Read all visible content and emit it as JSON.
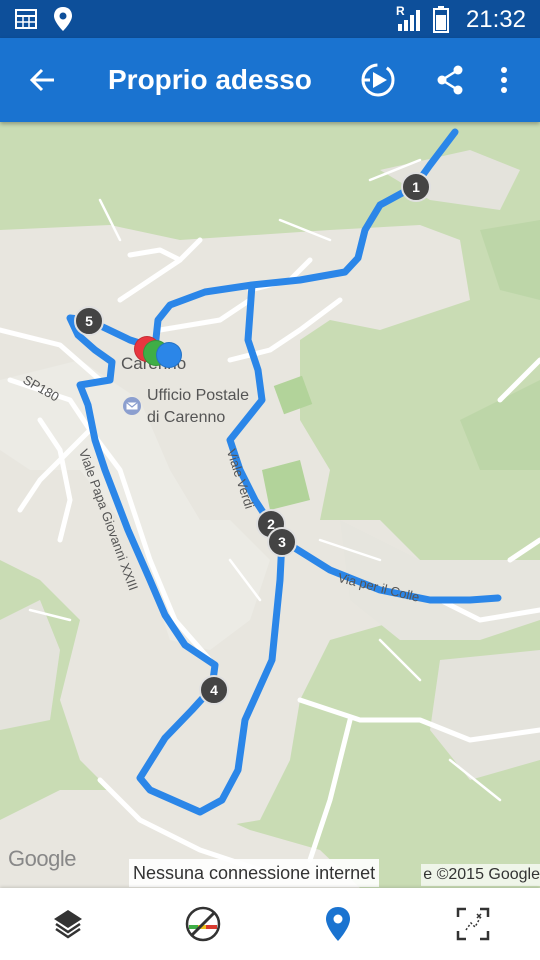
{
  "status_bar": {
    "time": "21:32",
    "network_indicator": "R",
    "icons": [
      "calendar-icon",
      "location-icon",
      "signal-icon",
      "battery-icon"
    ]
  },
  "app_bar": {
    "title": "Proprio adesso",
    "icons": [
      "back-arrow-icon",
      "play-route-icon",
      "share-icon",
      "more-vert-icon"
    ],
    "color": "#1a73d0",
    "status_color": "#0d4f9a"
  },
  "map": {
    "route_color": "#2b86e8",
    "place_labels": {
      "town": "Carenno",
      "post_office_line1": "Ufficio Postale",
      "post_office_line2": "di Carenno",
      "road_sp180": "SP180",
      "road_papa": "Viale Papa Giovanni XXIII",
      "road_verdi": "Viale Verdi",
      "road_colle": "Via per il Colle"
    },
    "waypoints": [
      "1",
      "2",
      "3",
      "4",
      "5"
    ],
    "notice": "Nessuna connessione internet",
    "copyright": "e ©2015 Google",
    "logo": "Google"
  },
  "bottom_bar": {
    "icons": [
      "layers-icon",
      "no-gps-icon",
      "location-pin-icon",
      "fullscreen-icon"
    ],
    "active_color": "#1a73d0"
  }
}
